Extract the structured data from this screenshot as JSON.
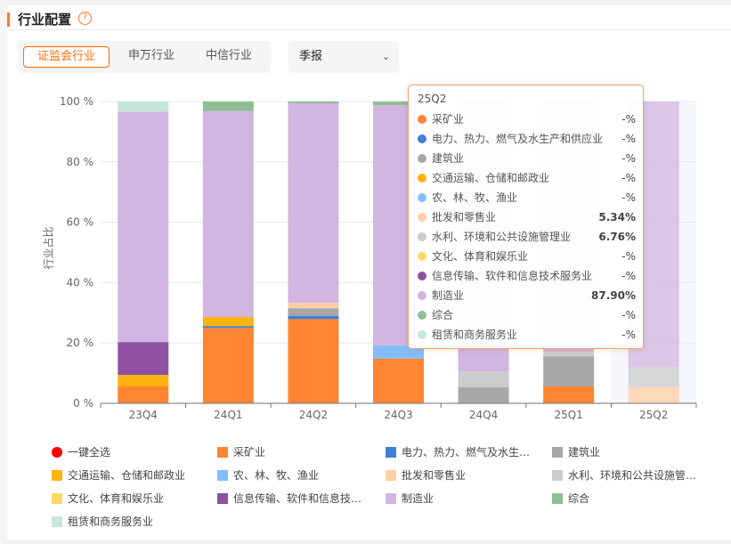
{
  "header": {
    "title": "行业配置",
    "help_icon": "question-circle-icon"
  },
  "tabs": [
    {
      "label": "证监会行业",
      "active": true
    },
    {
      "label": "申万行业",
      "active": false
    },
    {
      "label": "中信行业",
      "active": false
    }
  ],
  "period_select": {
    "value": "季报"
  },
  "accent": "#ff6a00",
  "chart_data": {
    "type": "bar",
    "stacked": true,
    "ylabel": "行业占比",
    "ylim": [
      0,
      100
    ],
    "yticks": [
      "0 %",
      "20 %",
      "40 %",
      "60 %",
      "80 %",
      "100 %"
    ],
    "categories": [
      "23Q4",
      "24Q1",
      "24Q2",
      "24Q3",
      "24Q4",
      "25Q1",
      "25Q2"
    ],
    "series": [
      {
        "name": "采矿业",
        "color": "#ff8533",
        "values": [
          5.6,
          25.0,
          27.9,
          14.8,
          0,
          5.6,
          0
        ]
      },
      {
        "name": "电力、热力、燃气及水生产和供应业",
        "color": "#3f7fd4",
        "values": [
          0,
          0.6,
          1.0,
          0,
          0,
          0,
          0
        ]
      },
      {
        "name": "建筑业",
        "color": "#a8a8a8",
        "values": [
          0,
          0,
          2.6,
          0,
          5.3,
          10.0,
          0
        ]
      },
      {
        "name": "交通运输、仓储和邮政业",
        "color": "#ffb30f",
        "values": [
          3.8,
          3.0,
          0,
          0,
          0,
          0,
          0
        ]
      },
      {
        "name": "农、林、牧、渔业",
        "color": "#85bbff",
        "values": [
          0,
          0,
          0,
          4.4,
          0,
          0,
          0
        ]
      },
      {
        "name": "批发和零售业",
        "color": "#ffcfa3",
        "values": [
          0,
          0,
          1.8,
          0,
          0,
          0,
          5.34
        ]
      },
      {
        "name": "水利、环境和公共设施管理业",
        "color": "#cccccc",
        "values": [
          0,
          0,
          0,
          0,
          5.3,
          1.5,
          6.76
        ]
      },
      {
        "name": "文化、体育和娱乐业",
        "color": "#ffd966",
        "values": [
          0,
          0,
          0,
          0,
          0,
          0,
          0
        ]
      },
      {
        "name": "信息传输、软件和信息技术服务业",
        "color": "#8e52a1",
        "values": [
          10.9,
          0,
          0,
          0,
          0,
          0,
          0
        ]
      },
      {
        "name": "制造业",
        "color": "#d2b5e0",
        "values": [
          76.3,
          68.3,
          66.1,
          79.6,
          89.4,
          82.9,
          87.9
        ]
      },
      {
        "name": "综合",
        "color": "#8fbf94",
        "values": [
          0,
          3.1,
          0.6,
          1.2,
          0,
          0,
          0
        ]
      },
      {
        "name": "租赁和商务服务业",
        "color": "#c5e6da",
        "values": [
          3.4,
          0,
          0,
          0,
          0,
          0,
          0
        ]
      }
    ],
    "highlighted": "25Q2",
    "legend_position": "bottom"
  },
  "tooltip": {
    "title": "25Q2",
    "rows": [
      {
        "name": "采矿业",
        "value": "-%"
      },
      {
        "name": "电力、热力、燃气及水生产和供应业",
        "value": "-%"
      },
      {
        "name": "建筑业",
        "value": "-%"
      },
      {
        "name": "交通运输、仓储和邮政业",
        "value": "-%"
      },
      {
        "name": "农、林、牧、渔业",
        "value": "-%"
      },
      {
        "name": "批发和零售业",
        "value": "5.34%"
      },
      {
        "name": "水利、环境和公共设施管理业",
        "value": "6.76%"
      },
      {
        "name": "文化、体育和娱乐业",
        "value": "-%"
      },
      {
        "name": "信息传输、软件和信息技术服务业",
        "value": "-%"
      },
      {
        "name": "制造业",
        "value": "87.90%"
      },
      {
        "name": "综合",
        "value": "-%"
      },
      {
        "name": "租赁和商务服务业",
        "value": "-%"
      }
    ]
  },
  "legend": {
    "select_all": "一键全选",
    "select_all_color": "#ff0000"
  }
}
